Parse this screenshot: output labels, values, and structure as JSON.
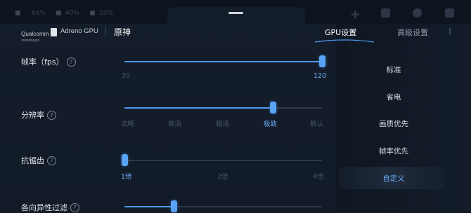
{
  "status_bar": {
    "items": [
      "66%",
      "40%",
      "10%"
    ]
  },
  "header": {
    "brand_line1": "Qualcomm",
    "brand_line2": "snapdragon",
    "gpu_brand": "Adreno GPU",
    "game_name": "原神",
    "tabs": [
      {
        "label": "GPU设置",
        "active": true
      },
      {
        "label": "高级设置",
        "active": false
      }
    ]
  },
  "settings": [
    {
      "label": "帧率（fps）",
      "ticks": [
        "30",
        "120"
      ],
      "value_fraction": 1.0,
      "active_tick": 1
    },
    {
      "label": "分辨率",
      "ticks": [
        "流畅",
        "高清",
        "超清",
        "极致",
        "默认"
      ],
      "value_fraction": 0.75,
      "active_tick": 3
    },
    {
      "label": "抗锯齿",
      "ticks": [
        "1倍",
        "2倍",
        "4倍"
      ],
      "value_fraction": 0.0,
      "active_tick": 0
    },
    {
      "label": "各向异性过滤",
      "ticks": [],
      "value_fraction": 0.25,
      "active_tick": -1
    }
  ],
  "help_glyph": "?",
  "presets": [
    {
      "label": "标准",
      "active": false
    },
    {
      "label": "省电",
      "active": false
    },
    {
      "label": "画质优先",
      "active": false
    },
    {
      "label": "帧率优先",
      "active": false
    },
    {
      "label": "自定义",
      "active": true
    }
  ],
  "colors": {
    "accent": "#59a2f6",
    "background": "#121a26",
    "track": "#2e3847"
  },
  "icons": [
    "battery-icon",
    "cpu-icon",
    "gpu-icon",
    "crosshair-icon",
    "grid-icon",
    "gear-icon",
    "phone-icon"
  ]
}
